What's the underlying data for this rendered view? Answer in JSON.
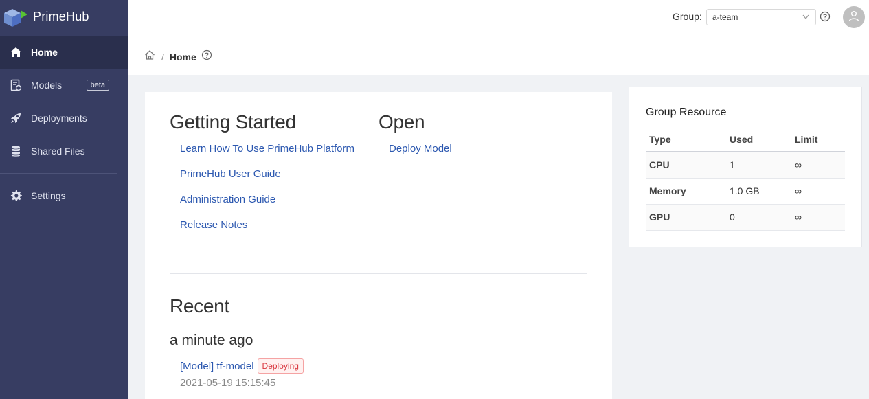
{
  "app": {
    "name": "PrimeHub"
  },
  "sidebar": {
    "items": [
      {
        "label": "Home",
        "icon": "home-icon",
        "active": true
      },
      {
        "label": "Models",
        "icon": "models-icon",
        "badge": "beta"
      },
      {
        "label": "Deployments",
        "icon": "rocket-icon"
      },
      {
        "label": "Shared Files",
        "icon": "database-icon"
      },
      {
        "label": "Settings",
        "icon": "gear-icon"
      }
    ]
  },
  "header": {
    "group_label": "Group:",
    "group_value": "a-team"
  },
  "breadcrumb": {
    "separator": "/",
    "current": "Home"
  },
  "getting_started": {
    "title": "Getting Started",
    "links": [
      "Learn How To Use PrimeHub Platform",
      "PrimeHub User Guide",
      "Administration Guide",
      "Release Notes"
    ]
  },
  "open": {
    "title": "Open",
    "links": [
      "Deploy Model"
    ]
  },
  "recent": {
    "title": "Recent",
    "group_title": "a minute ago",
    "item": {
      "label": "[Model] tf-model",
      "tag": "Deploying",
      "time": "2021-05-19 15:15:45"
    }
  },
  "group_resource": {
    "title": "Group Resource",
    "headers": [
      "Type",
      "Used",
      "Limit"
    ],
    "rows": [
      [
        "CPU",
        "1",
        "∞"
      ],
      [
        "Memory",
        "1.0 GB",
        "∞"
      ],
      [
        "GPU",
        "0",
        "∞"
      ]
    ]
  },
  "colors": {
    "sidebar": "#373d62",
    "sidebar_active": "#2a2f4d",
    "link": "#2c58b0",
    "tag_red": "#d9363e"
  }
}
